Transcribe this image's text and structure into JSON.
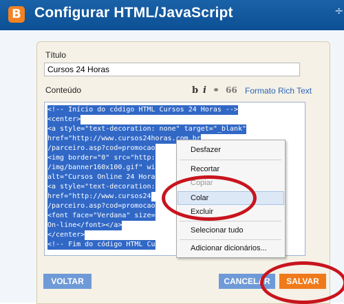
{
  "header": {
    "title": "Configurar HTML/JavaScript",
    "logo_letter": "B",
    "close_glyph": "÷"
  },
  "form": {
    "title_label": "Título",
    "title_value": "Cursos 24 Horas",
    "content_label": "Conteúdo",
    "toolbar": {
      "bold": "b",
      "italic": "i",
      "link": "⚭",
      "quote": "66",
      "rich_text": "Formato Rich Text"
    },
    "code_lines": [
      "<!-- Início do código HTML Cursos 24 Horas -->",
      "<center>",
      "<a style=\"text-decoration: none\" target=\"_blank\"",
      "href=\"http://www.cursos24horas.com.br",
      "/parceiro.asp?cod=promocao",
      "<img border=\"0\" src=\"http:",
      "/img/banner160x100.gif\" wi",
      "alt=\"Cursos Online 24 Hora",
      "<a style=\"text-decoration:",
      "href=\"http://www.cursos24",
      "/parceiro.asp?cod=promocao",
      "<font face=\"Verdana\" size=",
      "On-line</font></a>",
      "</center>",
      "<!-- Fim do código HTML Cu"
    ]
  },
  "context_menu": {
    "items": [
      "Desfazer",
      "Recortar",
      "Copiar",
      "Colar",
      "Excluir",
      "Selecionar tudo",
      "Adicionar dicionários..."
    ]
  },
  "buttons": {
    "back": "VOLTAR",
    "cancel": "CANCELAR",
    "save": "SALVAR"
  },
  "colors": {
    "header": "#0c4f94",
    "accent": "#f07a1a",
    "selection": "#3168c6",
    "annotation": "#c8141e"
  }
}
